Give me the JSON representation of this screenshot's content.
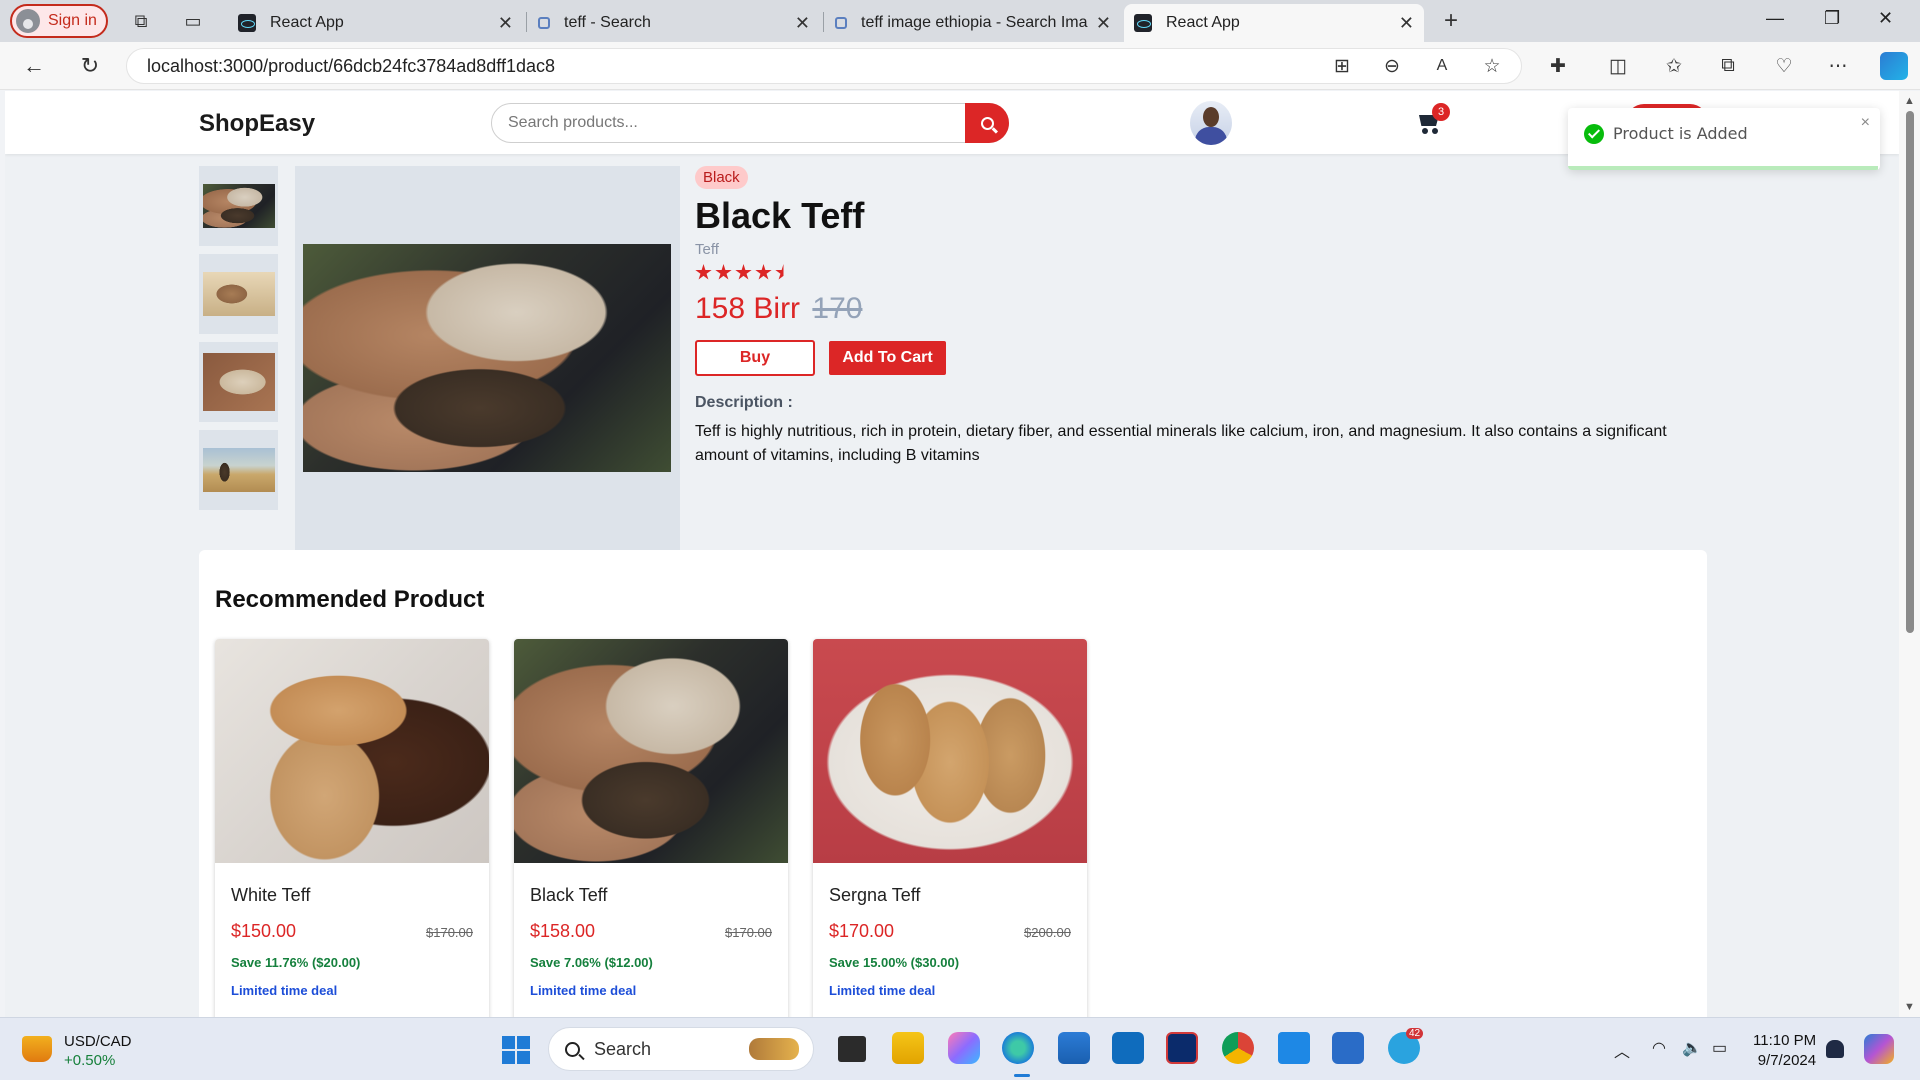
{
  "browser": {
    "signin_label": "Sign in",
    "tabs": [
      {
        "title": "React App",
        "icon": "react-icon",
        "active": false
      },
      {
        "title": "teff - Search",
        "icon": "search-icon",
        "active": false
      },
      {
        "title": "teff image ethiopia - Search Imag",
        "icon": "search-icon",
        "active": false
      },
      {
        "title": "React App",
        "icon": "react-icon",
        "active": true
      }
    ],
    "url": "localhost:3000/product/66dcb24fc3784ad8dff1dac8"
  },
  "header": {
    "logo": "ShopEasy",
    "search_placeholder": "Search products...",
    "cart_count": "3"
  },
  "toast": {
    "message": "Product is Added",
    "close": "×"
  },
  "product": {
    "tag": "Black",
    "name": "Black Teff",
    "category": "Teff",
    "rating": 4.5,
    "price": "158 Birr",
    "old_price": "170",
    "buy_label": "Buy",
    "add_to_cart_label": "Add To Cart",
    "description_label": "Description :",
    "description": "Teff is highly nutritious, rich in protein, dietary fiber, and essential minerals like calcium, iron, and magnesium. It also contains a significant amount of vitamins, including B vitamins"
  },
  "recommended": {
    "title": "Recommended Product",
    "items": [
      {
        "name": "White Teff",
        "price": "$150.00",
        "old_price": "$170.00",
        "save": "Save 11.76% ($20.00)",
        "deal": "Limited time deal"
      },
      {
        "name": "Black Teff",
        "price": "$158.00",
        "old_price": "$170.00",
        "save": "Save 7.06% ($12.00)",
        "deal": "Limited time deal"
      },
      {
        "name": "Sergna Teff",
        "price": "$170.00",
        "old_price": "$200.00",
        "save": "Save 15.00% ($30.00)",
        "deal": "Limited time deal"
      }
    ]
  },
  "taskbar": {
    "weather_title": "USD/CAD",
    "weather_value": "+0.50%",
    "search_label": "Search",
    "time": "11:10 PM",
    "date": "9/7/2024",
    "telegram_badge": "42"
  },
  "colors": {
    "accent": "#dc2626",
    "success": "#07bc0c",
    "deal_link": "#1d4ed8",
    "save_text": "#15803d"
  }
}
